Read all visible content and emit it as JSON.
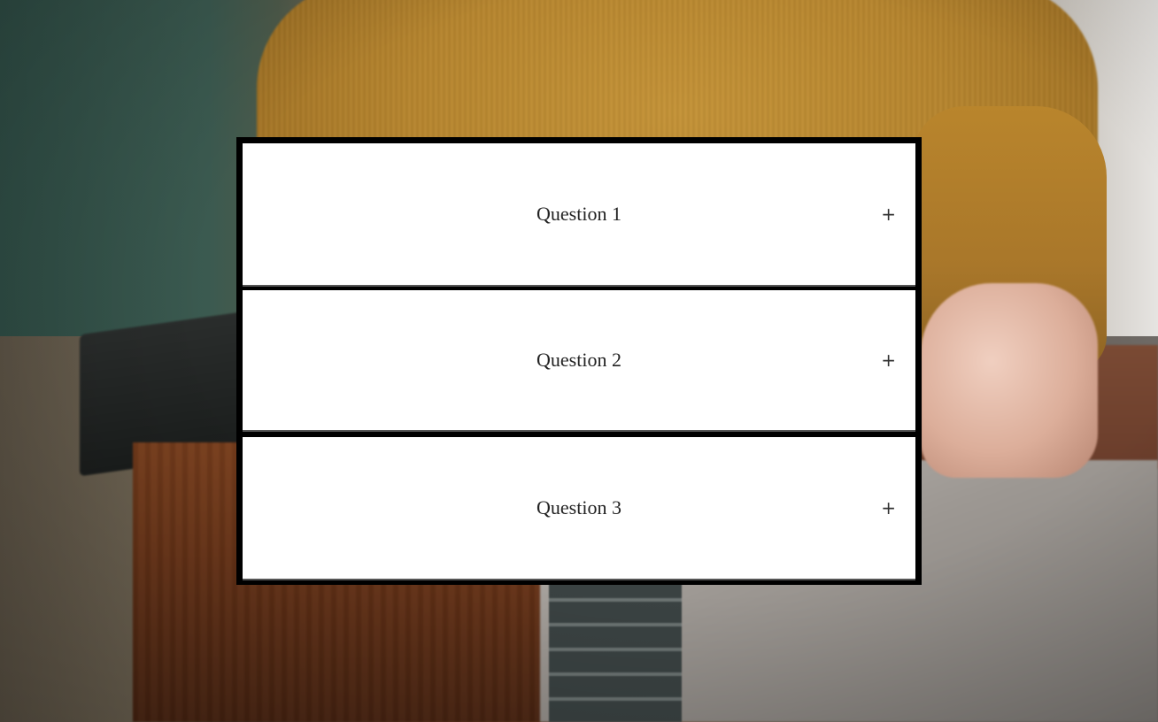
{
  "accordion": {
    "items": [
      {
        "title": "Question 1",
        "toggle_icon": "plus-icon",
        "toggle_glyph": "+",
        "expanded": false
      },
      {
        "title": "Question 2",
        "toggle_icon": "plus-icon",
        "toggle_glyph": "+",
        "expanded": false
      },
      {
        "title": "Question 3",
        "toggle_icon": "plus-icon",
        "toggle_glyph": "+",
        "expanded": false
      }
    ]
  },
  "colors": {
    "panel_border": "#000000",
    "item_background": "#ffffff",
    "text": "#222222"
  }
}
